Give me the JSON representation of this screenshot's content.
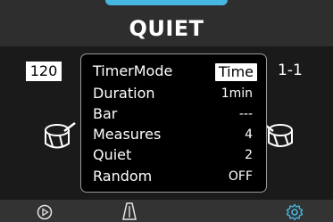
{
  "header": {
    "title": "QUIET"
  },
  "status": {
    "tempo": "120",
    "bar_position": "1-1"
  },
  "popup": {
    "rows": [
      {
        "label": "TimerMode",
        "value": "Time"
      },
      {
        "label": "Duration",
        "value": "1min"
      },
      {
        "label": "Bar",
        "value": "---"
      },
      {
        "label": "Measures",
        "value": "4"
      },
      {
        "label": "Quiet",
        "value": "2"
      },
      {
        "label": "Random",
        "value": "OFF"
      }
    ]
  },
  "footer": {
    "icons": [
      "play-icon",
      "metronome-icon",
      "settings-icon"
    ]
  },
  "colors": {
    "accent": "#46b7e3",
    "background": "#000000",
    "panel": "#2e2e2e"
  }
}
